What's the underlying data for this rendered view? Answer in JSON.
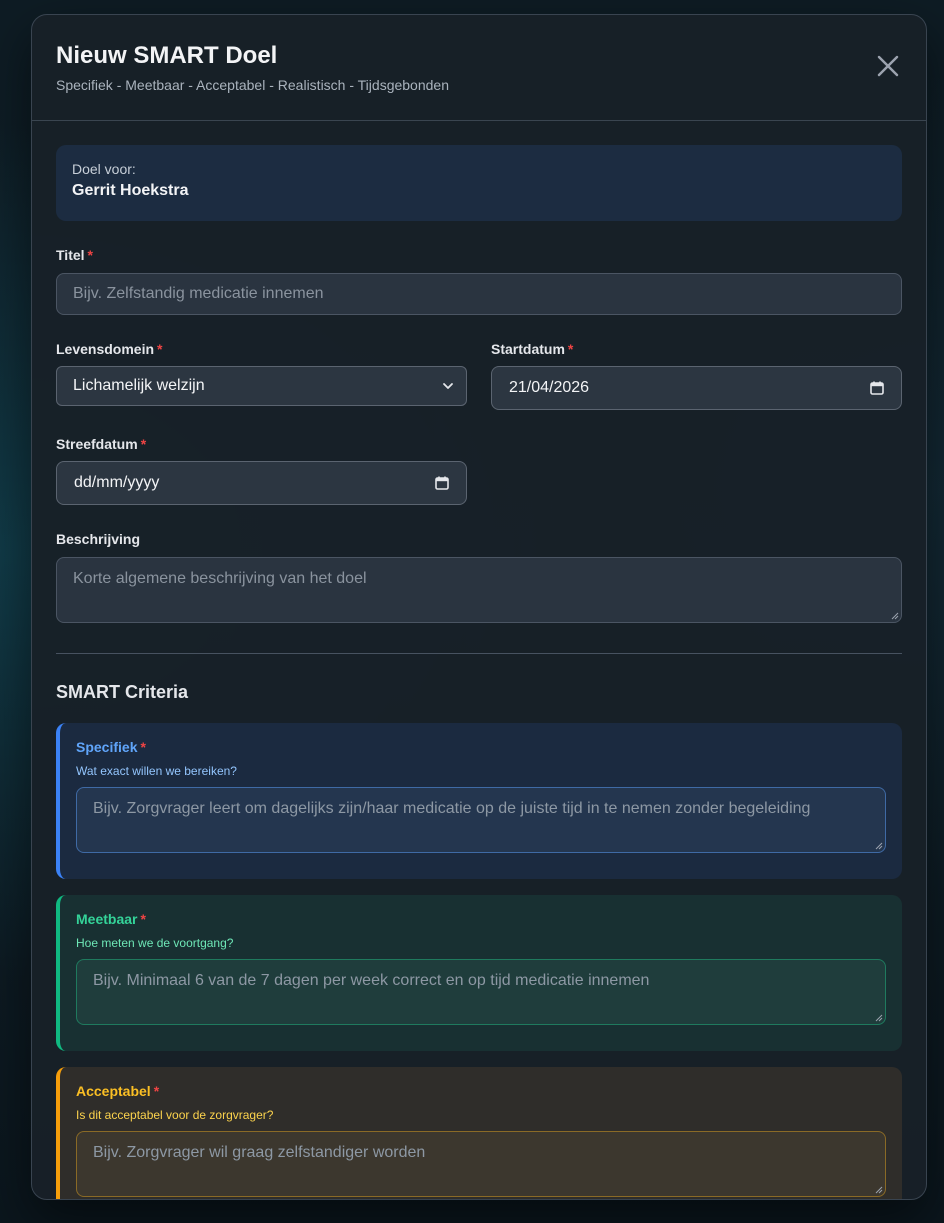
{
  "modal": {
    "title": "Nieuw SMART Doel",
    "subtitle": "Specifiek - Meetbaar - Acceptabel - Realistisch - Tijdsgebonden"
  },
  "client": {
    "label": "Doel voor:",
    "name": "Gerrit Hoekstra"
  },
  "form": {
    "title": {
      "label": "Titel",
      "placeholder": "Bijv. Zelfstandig medicatie innemen",
      "value": ""
    },
    "domain": {
      "label": "Levensdomein",
      "value": "Lichamelijk welzijn"
    },
    "start_date": {
      "label": "Startdatum",
      "value": "21/04/2026"
    },
    "target_date": {
      "label": "Streefdatum",
      "value": "dd/mm/yyyy"
    },
    "description": {
      "label": "Beschrijving",
      "placeholder": "Korte algemene beschrijving van het doel"
    },
    "required_mark": "*"
  },
  "smart": {
    "heading": "SMART Criteria",
    "criteria": [
      {
        "key": "s",
        "label": "Specifiek",
        "question": "Wat exact willen we bereiken?",
        "placeholder": "Bijv. Zorgvrager leert om dagelijks zijn/haar medicatie op de juiste tijd in te nemen zonder begeleiding",
        "color": "#3b82f6"
      },
      {
        "key": "m",
        "label": "Meetbaar",
        "question": "Hoe meten we de voortgang?",
        "placeholder": "Bijv. Minimaal 6 van de 7 dagen per week correct en op tijd medicatie innemen",
        "color": "#10b981"
      },
      {
        "key": "a",
        "label": "Acceptabel",
        "question": "Is dit acceptabel voor de zorgvrager?",
        "placeholder": "Bijv. Zorgvrager wil graag zelfstandiger worden",
        "color": "#f59e0b"
      }
    ]
  }
}
